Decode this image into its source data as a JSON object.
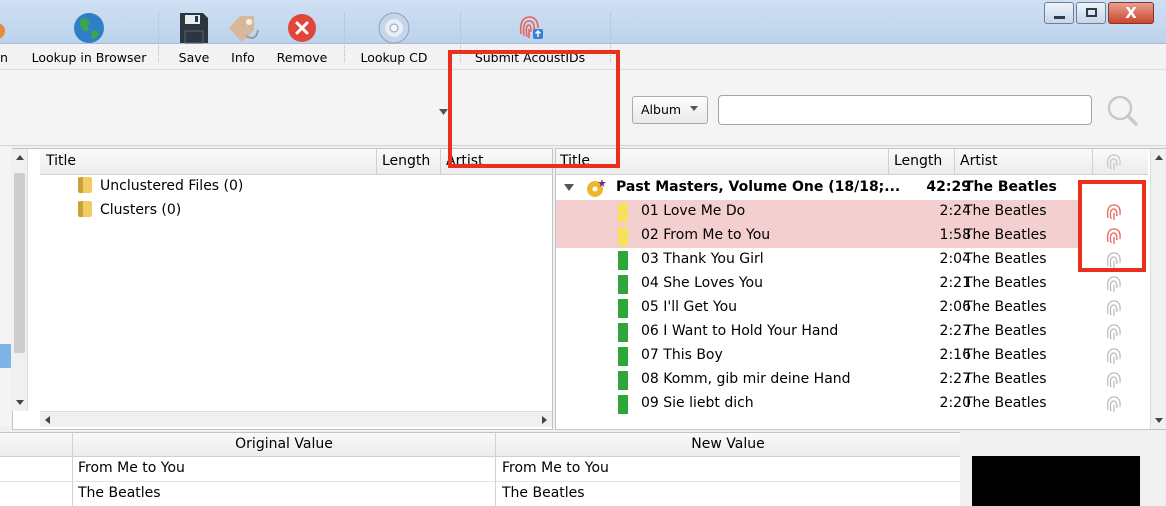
{
  "window": {
    "minimize": "–",
    "maximize": "□",
    "close": "X"
  },
  "toolbar": {
    "items": [
      {
        "label": "n",
        "icon": "partial-icon"
      },
      {
        "label": "Lookup in Browser",
        "icon": "globe-icon"
      },
      {
        "label": "Save",
        "icon": "floppy-disk-icon"
      },
      {
        "label": "Info",
        "icon": "tag-icon"
      },
      {
        "label": "Remove",
        "icon": "remove-circle-icon"
      },
      {
        "label": "Lookup CD",
        "icon": "cd-icon"
      },
      {
        "label": "Submit AcoustIDs",
        "icon": "fingerprint-icon"
      }
    ],
    "search_type": "Album",
    "search_value": ""
  },
  "left_pane": {
    "columns": [
      "Title",
      "Length",
      "Artist"
    ],
    "items": [
      {
        "label": "Unclustered Files (0)"
      },
      {
        "label": "Clusters (0)"
      }
    ]
  },
  "right_pane": {
    "columns": [
      "Title",
      "Length",
      "Artist"
    ],
    "album": {
      "title": "Past Masters, Volume One (18/18;...",
      "length": "42:29",
      "artist": "The Beatles"
    },
    "tracks": [
      {
        "title": "01 Love Me Do",
        "length": "2:24",
        "artist": "The Beatles",
        "highlight": true,
        "color": "#f7e15c"
      },
      {
        "title": "02 From Me to You",
        "length": "1:58",
        "artist": "The Beatles",
        "highlight": true,
        "color": "#f7e15c"
      },
      {
        "title": "03 Thank You Girl",
        "length": "2:04",
        "artist": "The Beatles",
        "highlight": false,
        "color": "#2fa63a"
      },
      {
        "title": "04 She Loves You",
        "length": "2:21",
        "artist": "The Beatles",
        "highlight": false,
        "color": "#2fa63a"
      },
      {
        "title": "05 I'll Get You",
        "length": "2:06",
        "artist": "The Beatles",
        "highlight": false,
        "color": "#2fa63a"
      },
      {
        "title": "06 I Want to Hold Your Hand",
        "length": "2:27",
        "artist": "The Beatles",
        "highlight": false,
        "color": "#2fa63a"
      },
      {
        "title": "07 This Boy",
        "length": "2:16",
        "artist": "The Beatles",
        "highlight": false,
        "color": "#2fa63a"
      },
      {
        "title": "08 Komm, gib mir deine Hand",
        "length": "2:27",
        "artist": "The Beatles",
        "highlight": false,
        "color": "#2fa63a"
      },
      {
        "title": "09 Sie liebt dich",
        "length": "2:20",
        "artist": "The Beatles",
        "highlight": false,
        "color": "#2fa63a"
      }
    ]
  },
  "metadata": {
    "columns": [
      "Original Value",
      "New Value"
    ],
    "rows": [
      {
        "original": "From Me to You",
        "new": "From Me to You"
      },
      {
        "original": "The Beatles",
        "new": "The Beatles"
      }
    ]
  },
  "colors": {
    "highlight_row": "#f3cfcf",
    "annotation_box": "#e8301c",
    "fingerprint_active": "#e8645a",
    "fingerprint_inactive": "#bdbdbd"
  }
}
